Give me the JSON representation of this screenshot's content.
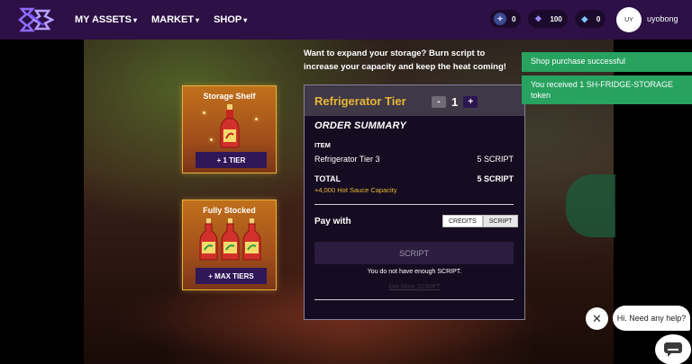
{
  "nav": {
    "menu": [
      {
        "label": "MY ASSETS"
      },
      {
        "label": "MARKET"
      },
      {
        "label": "SHOP"
      }
    ],
    "stats": [
      {
        "icon": "star-coin-icon",
        "value": "0"
      },
      {
        "icon": "ticket-icon",
        "value": "100"
      },
      {
        "icon": "gem-icon",
        "value": "0"
      }
    ],
    "avatar_initials": "UY",
    "username": "uyobong"
  },
  "cards": [
    {
      "title": "Storage Shelf",
      "button": "+ 1 TIER"
    },
    {
      "title": "Fully Stocked",
      "button": "+ MAX TIERS"
    }
  ],
  "description": "Want to expand your storage? Burn script to increase your capacity and keep the heat coming!",
  "order": {
    "tier_title": "Refrigerator Tier",
    "minus": "-",
    "quantity": "1",
    "plus": "+",
    "summary_heading": "ORDER SUMMARY",
    "item_label": "ITEM",
    "item_name": "Refrigerator Tier 3",
    "item_price": "5 SCRIPT",
    "total_label": "TOTAL",
    "total_price": "5 SCRIPT",
    "capacity": "+4,000 Hot Sauce Capacity",
    "pay_with": "Pay with",
    "pay_options": [
      "CREDITS",
      "SCRIPT"
    ],
    "pay_selected": "SCRIPT",
    "buy_button": "SCRIPT",
    "warning": "You do not have enough SCRIPT.",
    "get_more": "Get More SCRIPT"
  },
  "toasts": [
    "Shop purchase successful",
    "You received 1 SH-FRIDGE-STORAGE token"
  ],
  "help": {
    "close": "✕",
    "bubble": "Hi. Need any help?"
  },
  "colors": {
    "nav_bg": "#2c1046",
    "accent_gold": "#e8b636",
    "toast_green": "#27a25f",
    "button_purple": "#2f1758"
  }
}
